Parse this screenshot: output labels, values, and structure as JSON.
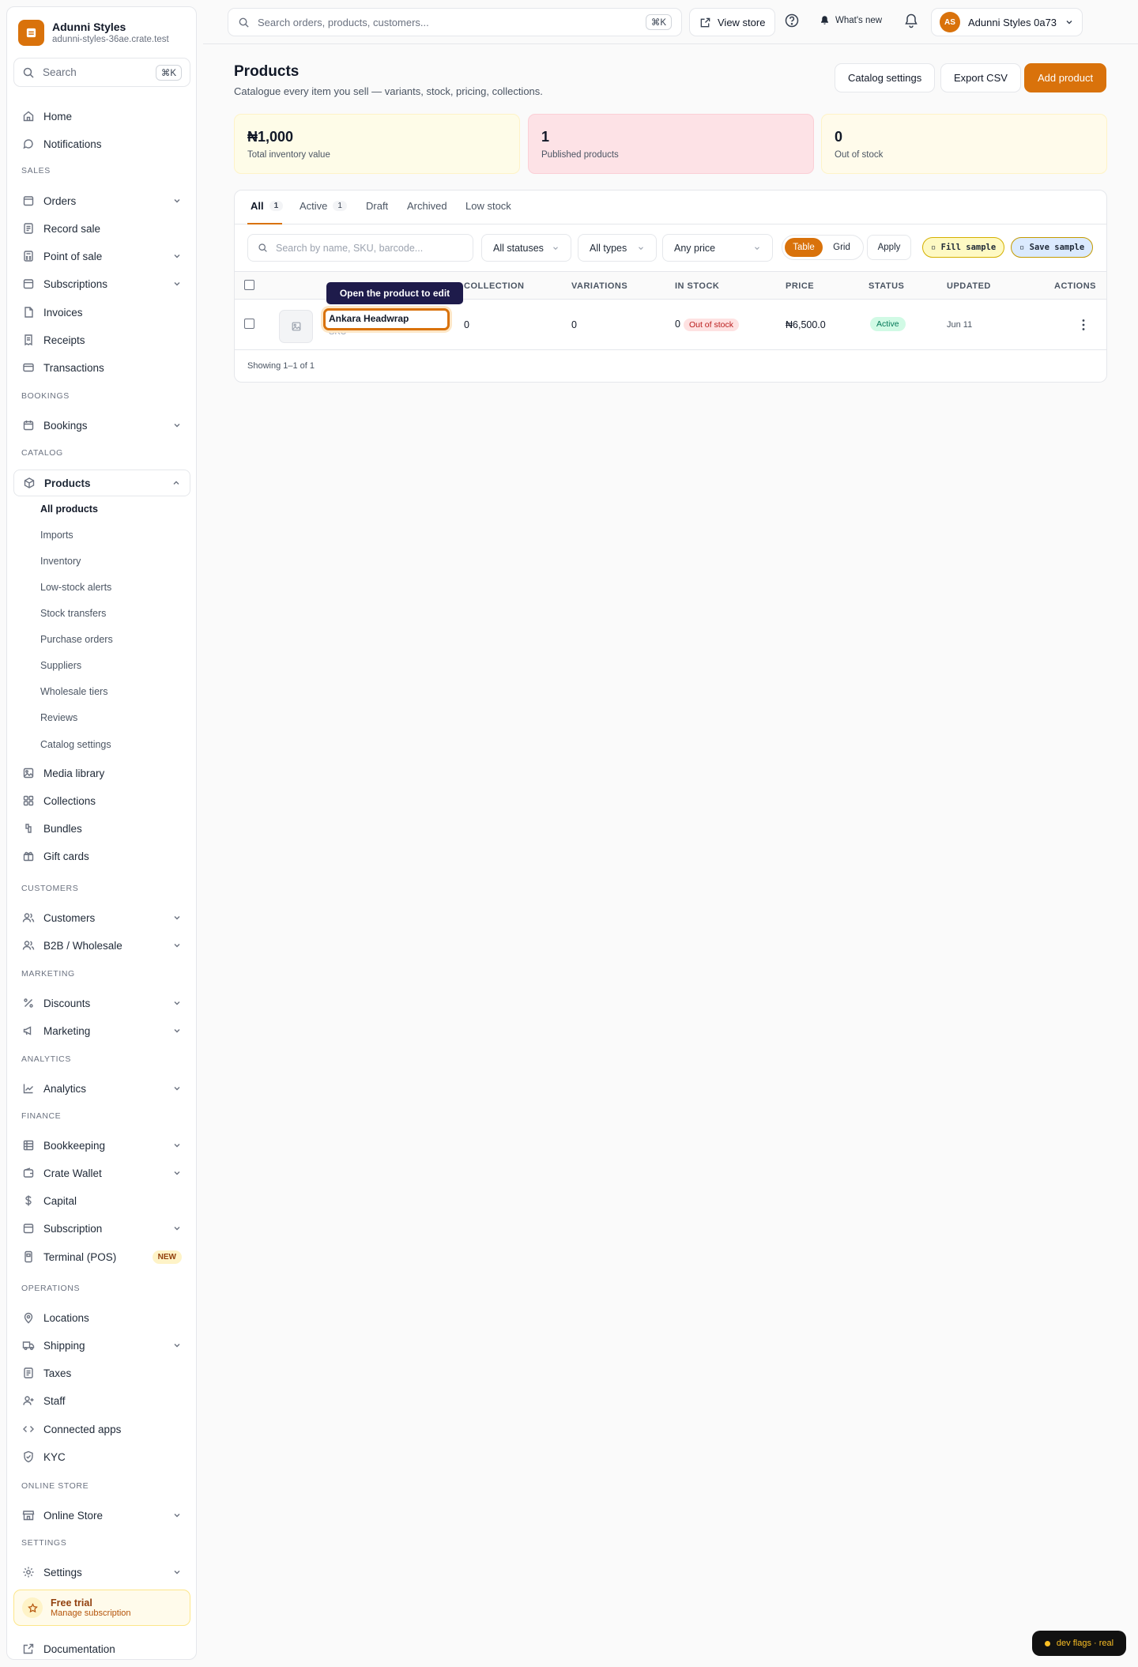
{
  "brand": {
    "name": "Adunni Styles",
    "domain": "adunni-styles-36ae.crate.test"
  },
  "sidebar": {
    "search_placeholder": "Search",
    "search_kbd": "⌘K",
    "home": "Home",
    "notifications": "Notifications",
    "sections": {
      "sales": "SALES",
      "bookings": "BOOKINGS",
      "catalog": "CATALOG",
      "customers": "CUSTOMERS",
      "marketing": "MARKETING",
      "analytics": "ANALYTICS",
      "finance": "FINANCE",
      "operations": "OPERATIONS",
      "online_store": "ONLINE STORE",
      "settings": "SETTINGS"
    },
    "sales_items": [
      "Orders",
      "Record sale",
      "Point of sale",
      "Subscriptions",
      "Invoices",
      "Receipts",
      "Transactions"
    ],
    "bookings_items": [
      "Bookings"
    ],
    "products": "Products",
    "product_subitems": [
      "All products",
      "Imports",
      "Inventory",
      "Low-stock alerts",
      "Stock transfers",
      "Purchase orders",
      "Suppliers",
      "Wholesale tiers",
      "Reviews",
      "Catalog settings"
    ],
    "catalog_items": [
      "Media library",
      "Collections",
      "Bundles",
      "Gift cards"
    ],
    "customers_items": [
      "Customers",
      "B2B / Wholesale"
    ],
    "marketing_items": [
      "Discounts",
      "Marketing"
    ],
    "analytics_items": [
      "Analytics"
    ],
    "finance_items": [
      "Bookkeeping",
      "Crate Wallet",
      "Capital",
      "Subscription",
      "Terminal (POS)"
    ],
    "new_badge": "NEW",
    "operations_items": [
      "Locations",
      "Shipping",
      "Taxes",
      "Staff",
      "Connected apps",
      "KYC"
    ],
    "online_store_items": [
      "Online Store"
    ],
    "settings_items": [
      "Settings"
    ],
    "trial": {
      "title": "Free trial",
      "subtitle": "Manage subscription"
    },
    "documentation": "Documentation"
  },
  "topbar": {
    "search_placeholder": "Search orders, products, customers...",
    "search_kbd": "⌘K",
    "view_store": "View store",
    "whats_new": "What's new",
    "account_initials": "AS",
    "account_name": "Adunni Styles 0a73"
  },
  "page": {
    "title": "Products",
    "subtitle": "Catalogue every item you sell — variants, stock, pricing, collections.",
    "buttons": {
      "catalog_settings": "Catalog settings",
      "export_csv": "Export CSV",
      "add_product": "Add product"
    }
  },
  "stats": [
    {
      "value": "₦1,000",
      "label": "Total inventory value"
    },
    {
      "value": "1",
      "label": "Published products"
    },
    {
      "value": "0",
      "label": "Out of stock"
    }
  ],
  "tabs": [
    {
      "label": "All",
      "count": "1"
    },
    {
      "label": "Active",
      "count": "1"
    },
    {
      "label": "Draft"
    },
    {
      "label": "Archived"
    },
    {
      "label": "Low stock"
    }
  ],
  "filters": {
    "search_placeholder": "Search by name, SKU, barcode...",
    "status": "All statuses",
    "type": "All types",
    "price": "Any price",
    "view_table": "Table",
    "view_grid": "Grid",
    "apply": "Apply",
    "fill_sample": "▫ Fill sample",
    "save_sample": "▫ Save sample"
  },
  "table": {
    "columns": {
      "collection": "COLLECTION",
      "variations": "VARIATIONS",
      "in_stock": "IN STOCK",
      "price": "PRICE",
      "status": "STATUS",
      "updated": "UPDATED",
      "actions": "ACTIONS"
    },
    "tooltip": "Open the product to edit",
    "row": {
      "name": "Ankara Headwrap",
      "sku": "SKU —",
      "collection": "0",
      "variations": "0",
      "in_stock": "0",
      "stock_badge": "Out of stock",
      "price": "₦6,500.0",
      "status": "Active",
      "updated": "Jun 11"
    },
    "showing": "Showing 1–1 of 1"
  },
  "dev_flags": "dev flags · real"
}
